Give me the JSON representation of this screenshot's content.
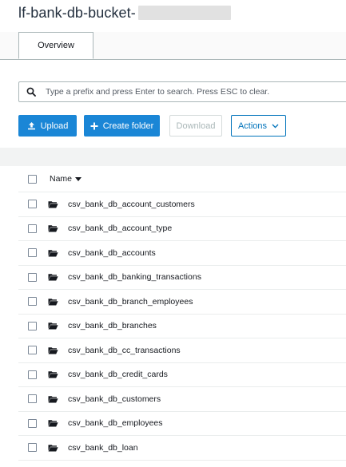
{
  "header": {
    "title": "lf-bank-db-bucket-"
  },
  "tabs": [
    {
      "label": "Overview",
      "active": true
    }
  ],
  "search": {
    "placeholder": "Type a prefix and press Enter to search. Press ESC to clear.",
    "value": ""
  },
  "toolbar": {
    "upload_label": "Upload",
    "create_folder_label": "Create folder",
    "download_label": "Download",
    "actions_label": "Actions"
  },
  "table": {
    "name_header": "Name",
    "rows": [
      {
        "name": "csv_bank_db_account_customers"
      },
      {
        "name": "csv_bank_db_account_type"
      },
      {
        "name": "csv_bank_db_accounts"
      },
      {
        "name": "csv_bank_db_banking_transactions"
      },
      {
        "name": "csv_bank_db_branch_employees"
      },
      {
        "name": "csv_bank_db_branches"
      },
      {
        "name": "csv_bank_db_cc_transactions"
      },
      {
        "name": "csv_bank_db_credit_cards"
      },
      {
        "name": "csv_bank_db_customers"
      },
      {
        "name": "csv_bank_db_employees"
      },
      {
        "name": "csv_bank_db_loan"
      }
    ]
  },
  "icons": {
    "search": "search-icon",
    "upload": "upload-icon",
    "create_folder": "plus-icon",
    "actions": "chevron-down-icon",
    "sort": "sort-caret-icon",
    "folder": "folder-icon"
  },
  "colors": {
    "primary": "#1a86d6",
    "link": "#0073bb",
    "disabled": "#aab7b8",
    "border": "#aab7b8",
    "band": "#f2f3f3",
    "title": "#232f3e"
  }
}
